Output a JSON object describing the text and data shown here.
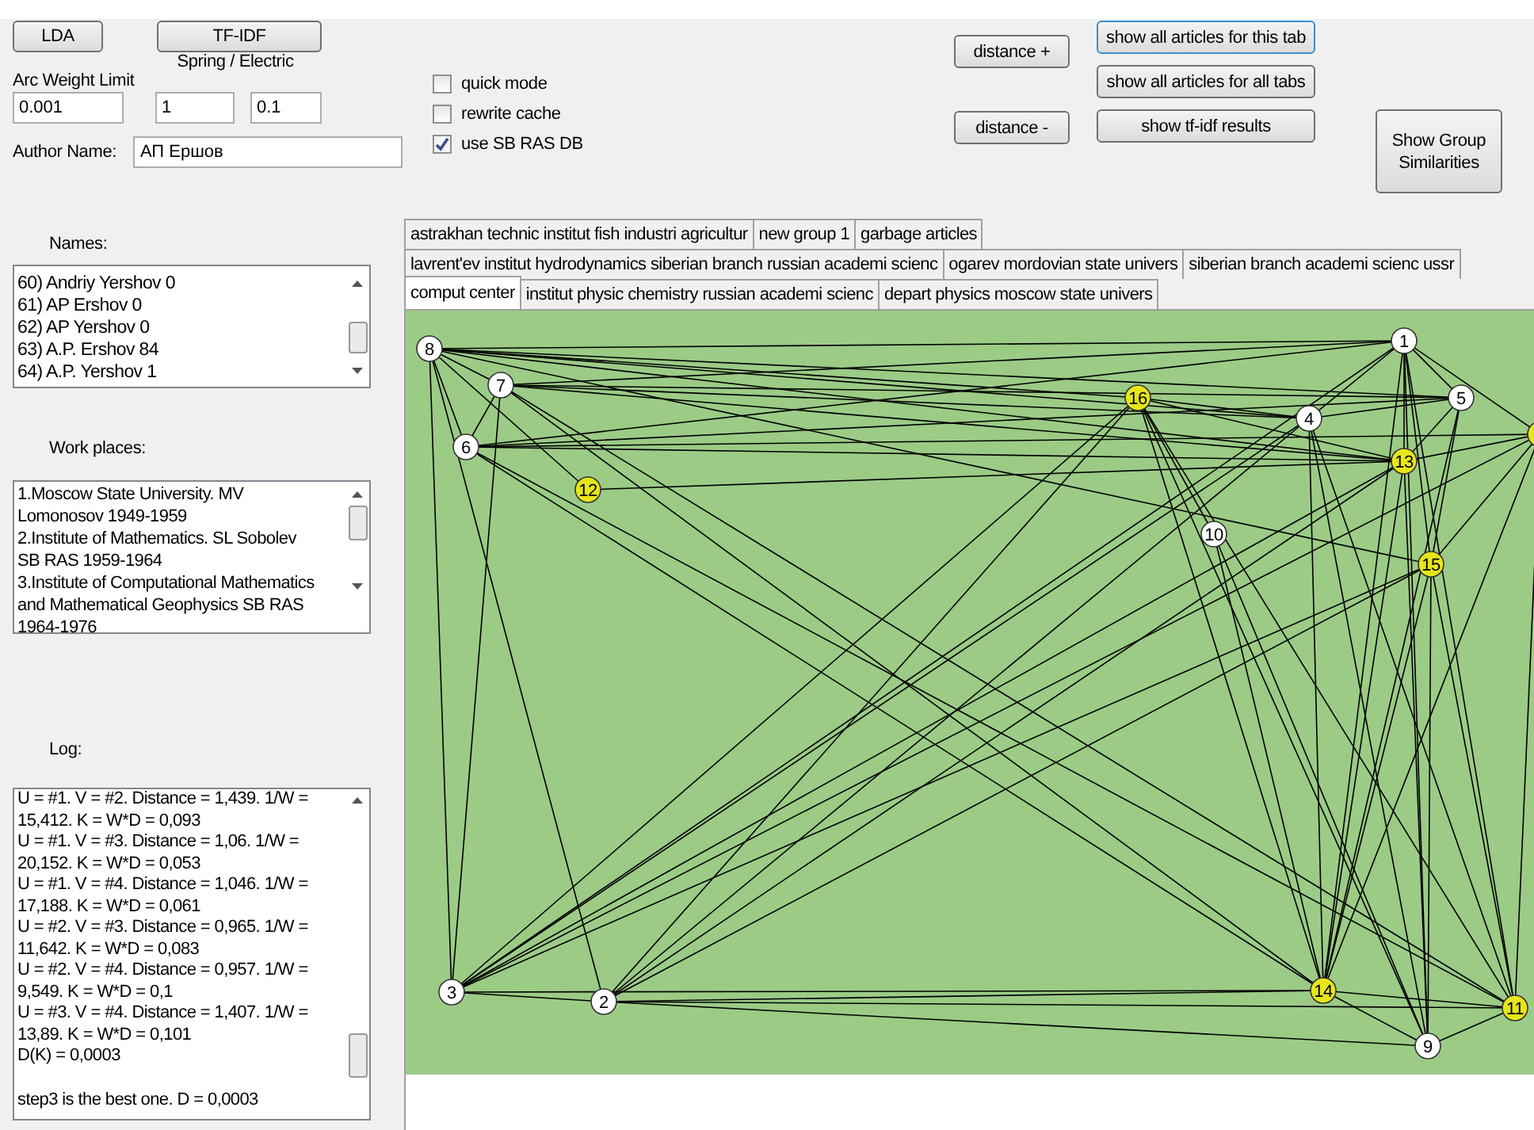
{
  "toolbar": {
    "buttons": [
      "LDA",
      "TF-IDF"
    ],
    "arc_weight_label": "Arc Weight Limit",
    "arc_weight_value": "0.001",
    "spring_label": "Spring / Electric",
    "spring_value": "1",
    "electric_value": "0.1",
    "author_label": "Author Name:",
    "author_value": "АП Ершов"
  },
  "options": [
    {
      "label": "quick mode",
      "checked": false
    },
    {
      "label": "rewrite cache",
      "checked": false
    },
    {
      "label": "use SB RAS DB",
      "checked": true
    }
  ],
  "actions": {
    "distance_plus": "distance +",
    "distance_minus": "distance -",
    "show_tab": "show all articles for this tab",
    "show_all": "show all articles for all tabs",
    "show_tfidf": "show tf-idf results",
    "group_similarities": "Show Group Similarities"
  },
  "names": {
    "label": "Names:",
    "items": [
      "60) Andriy Yershov 0",
      "61) AP Ershov 0",
      "62) AP Yershov 0",
      "63) A.P. Ershov 84",
      "64) A.P. Yershov 1"
    ]
  },
  "work_places": {
    "label": "Work places:",
    "lines": [
      "1.Moscow State University. MV",
      "Lomonosov 1949-1959",
      "2.Institute of Mathematics. SL Sobolev",
      "SB RAS 1959-1964",
      "3.Institute of Computational Mathematics",
      "and Mathematical Geophysics SB RAS",
      "1964-1976"
    ]
  },
  "log": {
    "label": "Log:",
    "lines": [
      "U = #1. V = #2. Distance = 1,439. 1/W =",
      "15,412. K = W*D = 0,093",
      "U = #1. V = #3. Distance = 1,06. 1/W =",
      "20,152. K = W*D = 0,053",
      "U = #1. V = #4. Distance = 1,046. 1/W =",
      "17,188. K = W*D = 0,061",
      "U = #2. V = #3. Distance = 0,965. 1/W =",
      "11,642. K = W*D = 0,083",
      "U = #2. V = #4. Distance = 0,957. 1/W =",
      "9,549. K = W*D = 0,1",
      "U = #3. V = #4. Distance = 1,407. 1/W =",
      "13,89. K = W*D = 0,101",
      "D(K) = 0,0003"
    ],
    "result": "step3 is the best one. D = 0,0003"
  },
  "tab_rows": [
    [
      {
        "label": "astrakhan technic institut fish industri agricultur",
        "selected": false
      },
      {
        "label": "new group 1",
        "selected": false
      },
      {
        "label": "garbage articles",
        "selected": false
      }
    ],
    [
      {
        "label": "lavrent'ev institut hydrodynamics siberian branch russian academi scienc",
        "selected": false
      },
      {
        "label": "ogarev mordovian state univers",
        "selected": false
      },
      {
        "label": "siberian branch academi scienc ussr",
        "selected": false
      }
    ],
    [
      {
        "label": "comput center",
        "selected": true
      },
      {
        "label": "institut physic chemistry russian academi scienc",
        "selected": false
      },
      {
        "label": "depart physics moscow state univers",
        "selected": false
      }
    ]
  ],
  "graph": {
    "nodes": [
      {
        "label": "1",
        "color": "#ffffff"
      },
      {
        "label": "2",
        "color": "#ffffff"
      },
      {
        "label": "3",
        "color": "#ffffff"
      },
      {
        "label": "4",
        "color": "#ffffff"
      },
      {
        "label": "5",
        "color": "#ffffff"
      },
      {
        "label": "6",
        "color": "#ffffff"
      },
      {
        "label": "7",
        "color": "#ffffff"
      },
      {
        "label": "8",
        "color": "#ffffff"
      },
      {
        "label": "9",
        "color": "#ffffff"
      },
      {
        "label": "10",
        "color": "#ffffff"
      },
      {
        "label": "11",
        "color": "#e6e619"
      },
      {
        "label": "12",
        "color": "#e6e619"
      },
      {
        "label": "13",
        "color": "#e6e619"
      },
      {
        "label": "14",
        "color": "#e6e619"
      },
      {
        "label": "15",
        "color": "#e6e619"
      },
      {
        "label": "16",
        "color": "#e6e619"
      },
      {
        "color": "#e6e619"
      }
    ]
  }
}
